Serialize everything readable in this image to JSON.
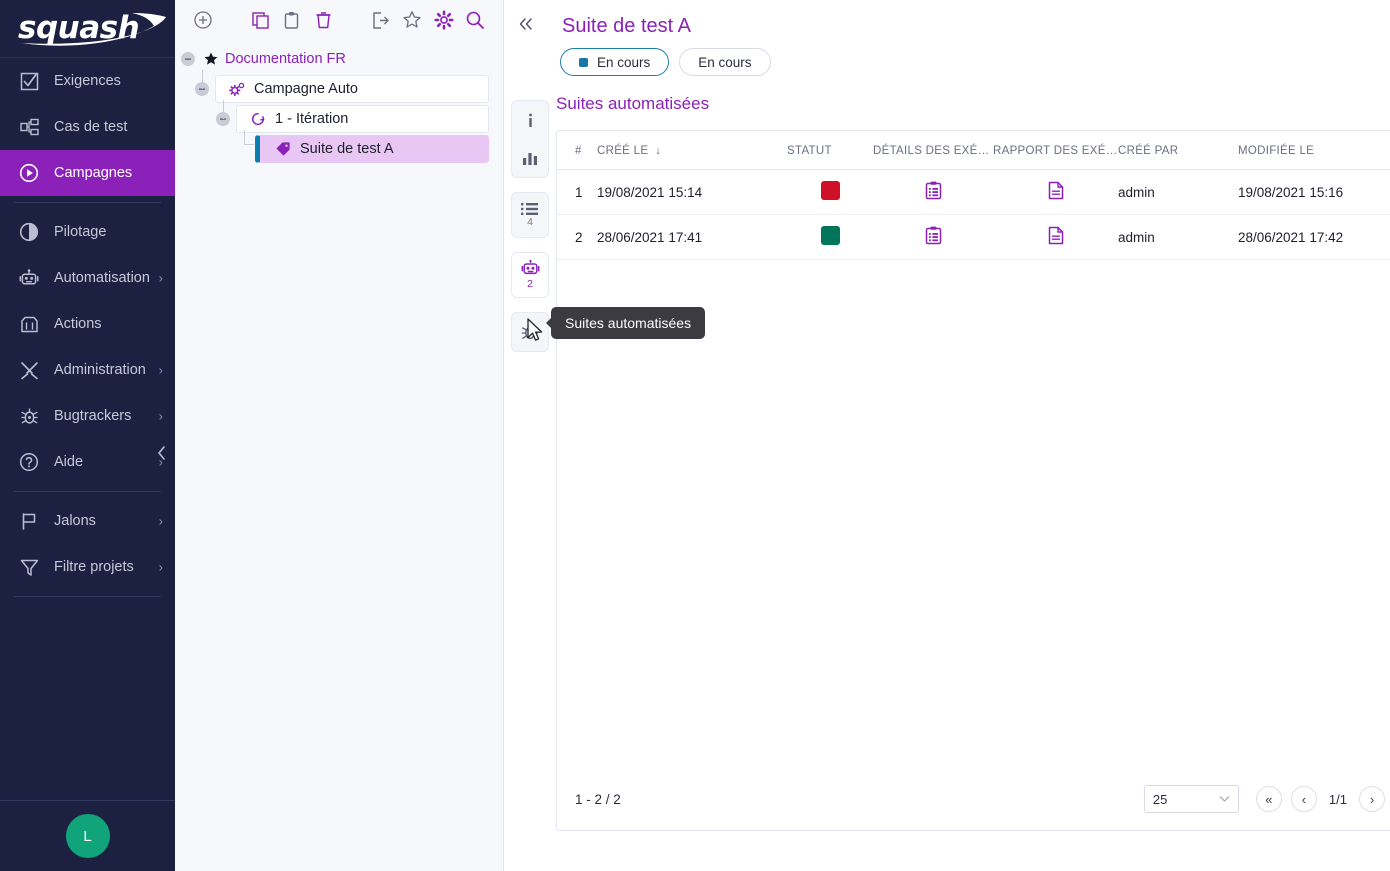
{
  "brand": {
    "logo_text": "squash",
    "accent": "#8B21B8",
    "nav_bg": "#1c2141"
  },
  "sidebar": {
    "items": [
      {
        "label": "Exigences",
        "icon": "requirements-icon",
        "active": false,
        "expandable": false
      },
      {
        "label": "Cas de test",
        "icon": "test-case-tree-icon",
        "active": false,
        "expandable": false
      },
      {
        "label": "Campagnes",
        "icon": "campaign-play-icon",
        "active": true,
        "expandable": false
      },
      {
        "label": "Pilotage",
        "icon": "pie-chart-icon",
        "active": false,
        "expandable": false
      },
      {
        "label": "Automatisation",
        "icon": "robot-icon",
        "active": false,
        "expandable": true
      },
      {
        "label": "Actions",
        "icon": "actions-icon",
        "active": false,
        "expandable": false
      },
      {
        "label": "Administration",
        "icon": "tools-icon",
        "active": false,
        "expandable": true
      },
      {
        "label": "Bugtrackers",
        "icon": "bug-icon",
        "active": false,
        "expandable": true
      },
      {
        "label": "Aide",
        "icon": "help-circle-icon",
        "active": false,
        "expandable": true
      },
      {
        "label": "Jalons",
        "icon": "flag-icon",
        "active": false,
        "expandable": true
      },
      {
        "label": "Filtre projets",
        "icon": "funnel-icon",
        "active": false,
        "expandable": true
      }
    ],
    "collapse_icon": "chevron-left-icon",
    "avatar_initial": "L"
  },
  "tree": {
    "toolbar": [
      {
        "name": "add-icon",
        "color": "#6b6f80"
      },
      {
        "name": "copy-icon",
        "color": "#8B21B8"
      },
      {
        "name": "paste-clipboard-icon",
        "color": "#6b6f80"
      },
      {
        "name": "delete-trash-icon",
        "color": "#8B21B8"
      },
      {
        "name": "export-icon",
        "color": "#6b6f80"
      },
      {
        "name": "star-icon",
        "color": "#6b6f80"
      },
      {
        "name": "settings-gear-icon",
        "color": "#8B21B8"
      },
      {
        "name": "search-icon",
        "color": "#8B21B8"
      }
    ],
    "root": {
      "label": "Documentation FR",
      "icon": "star-filled-icon"
    },
    "nodes": [
      {
        "label": "Campagne Auto",
        "icon": "campaign-icon",
        "selected": false
      },
      {
        "label": "1 - Itération",
        "icon": "iteration-icon",
        "selected": false
      },
      {
        "label": "Suite de test A",
        "icon": "test-suite-tag-icon",
        "selected": true
      }
    ]
  },
  "header": {
    "collapse_icon": "double-chevron-left-icon",
    "title": "Suite de test A",
    "attachment_icon": "paperclip-icon",
    "pills": [
      {
        "label": "En cours",
        "selected": true,
        "dot_color": "#1776a3"
      },
      {
        "label": "En cours",
        "selected": false
      }
    ]
  },
  "rail": {
    "buttons": [
      {
        "name": "info-icon",
        "count": null,
        "active": false
      },
      {
        "name": "bar-chart-icon",
        "count": null,
        "active": false
      },
      {
        "name": "test-list-icon",
        "count": "4",
        "active": false
      },
      {
        "name": "automated-robot-icon",
        "count": "2",
        "active": true
      },
      {
        "name": "bug-icon",
        "count": null,
        "active": false
      }
    ]
  },
  "main": {
    "section_title": "Suites automatisées",
    "table": {
      "columns": [
        {
          "label": "#",
          "key": "num"
        },
        {
          "label": "CRÉÉ LE",
          "key": "created",
          "sort": "desc"
        },
        {
          "label": "STATUT",
          "key": "status"
        },
        {
          "label": "DÉTAILS DES EXÉCU...",
          "key": "details"
        },
        {
          "label": "RAPPORT DES EXÉC...",
          "key": "report"
        },
        {
          "label": "CRÉÉ PAR",
          "key": "author"
        },
        {
          "label": "MODIFIÉE LE",
          "key": "modified"
        }
      ],
      "rows": [
        {
          "num": "1",
          "created": "19/08/2021 15:14",
          "status_color": "#CE1126",
          "details_icon": "execution-details-icon",
          "report_icon": "report-document-icon",
          "author": "admin",
          "modified": "19/08/2021 15:16"
        },
        {
          "num": "2",
          "created": "28/06/2021 17:41",
          "status_color": "#00755B",
          "details_icon": "execution-details-icon",
          "report_icon": "report-document-icon",
          "author": "admin",
          "modified": "28/06/2021 17:42"
        }
      ]
    },
    "footer": {
      "range": "1 - 2 / 2",
      "page_size": "25",
      "page_indicator": "1/1",
      "first_label": "«",
      "prev_label": "‹",
      "next_label": "›",
      "last_label": "»"
    }
  },
  "tooltip": {
    "text": "Suites automatisées"
  }
}
